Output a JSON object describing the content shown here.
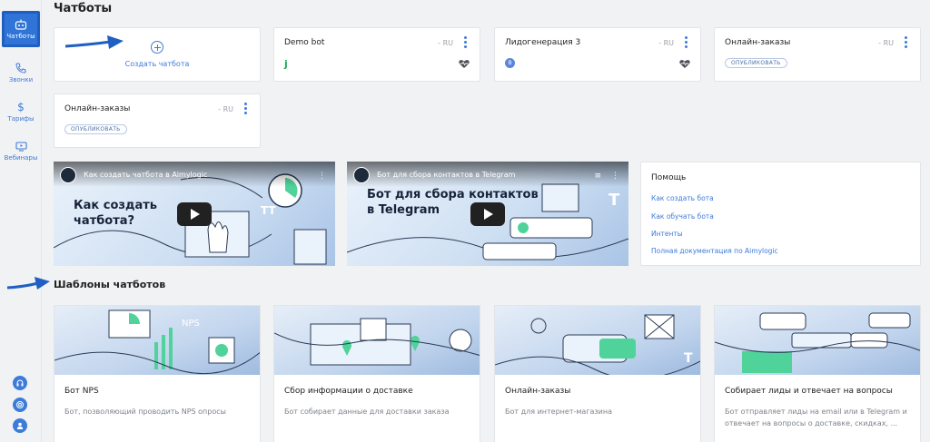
{
  "sidebar": {
    "items": [
      {
        "label": "Чатботы",
        "icon": "robot-icon"
      },
      {
        "label": "Звонки",
        "icon": "phone-icon"
      },
      {
        "label": "Тарифы",
        "icon": "dollar-icon"
      },
      {
        "label": "Вебинары",
        "icon": "monitor-icon"
      }
    ],
    "bottom_icons": [
      "headset-icon",
      "support-icon",
      "user-icon"
    ]
  },
  "page_title": "Чатботы",
  "create_label": "Создать чатбота",
  "bots": [
    {
      "name": "Demo bot",
      "lang": "- RU",
      "channel": "jivo-icon"
    },
    {
      "name": "Лидогенерация 3",
      "lang": "- RU",
      "channel": "vk-icon"
    },
    {
      "name": "Онлайн-заказы",
      "lang": "- RU",
      "badge": "ОПУБЛИКОВАТЬ"
    },
    {
      "name": "Онлайн-заказы",
      "lang": "- RU",
      "badge": "ОПУБЛИКОВАТЬ"
    }
  ],
  "videos": [
    {
      "title": "Как создать чатбота в Aimylogic",
      "big_line1": "Как создать",
      "big_line2": "чатбота?"
    },
    {
      "title": "Бот для сбора контактов в Telegram",
      "big_line1": "Бот для сбора контактов",
      "big_line2": "в Telegram"
    }
  ],
  "help": {
    "title": "Помощь",
    "links": [
      "Как создать бота",
      "Как обучать бота",
      "Интенты",
      "Полная документация по Aimylogic"
    ]
  },
  "templates_title": "Шаблоны чатботов",
  "templates": [
    {
      "name": "Бот NPS",
      "desc": "Бот, позволяющий проводить NPS опросы"
    },
    {
      "name": "Сбор информации о доставке",
      "desc": "Бот собирает данные для доставки заказа"
    },
    {
      "name": "Онлайн-заказы",
      "desc": "Бот для интернет-магазина"
    },
    {
      "name": "Собирает лиды и отвечает на вопросы",
      "desc": "Бот отправляет лиды на email или в Telegram и отвечает на вопросы о доставке, скидках, ..."
    }
  ],
  "art_text": {
    "nps": "NPS"
  },
  "colors": {
    "accent": "#3d7bd9",
    "active_nav": "#2f74d6",
    "green": "#4fd39a"
  }
}
